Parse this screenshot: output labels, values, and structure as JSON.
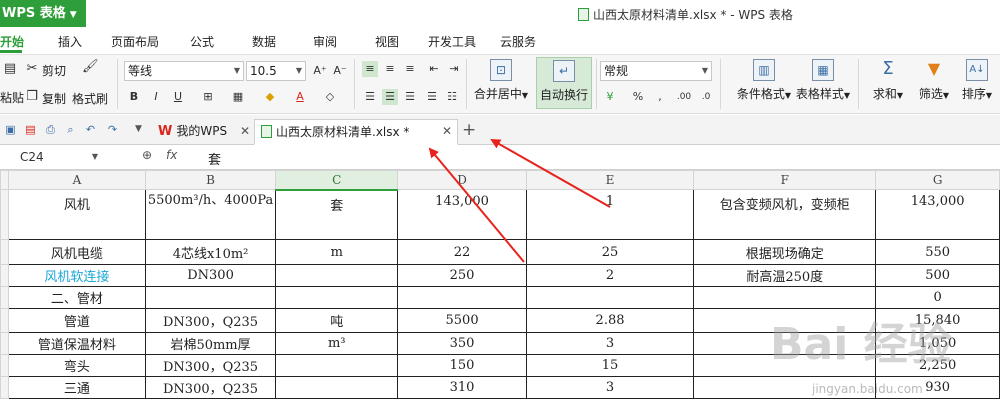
{
  "titlebar": {
    "app_label": "WPS 表格",
    "doc_title": "山西太原材料清单.xlsx * - WPS 表格"
  },
  "menu": {
    "tabs": [
      "开始",
      "插入",
      "页面布局",
      "公式",
      "数据",
      "审阅",
      "视图",
      "开发工具",
      "云服务"
    ]
  },
  "ribbon": {
    "paste": "粘贴",
    "cut": "剪切",
    "copy": "复制",
    "format_painter": "格式刷",
    "font_name": "等线",
    "font_size": "10.5",
    "merge_center": "合并居中",
    "wrap_text": "自动换行",
    "number_format": "常规",
    "conditional_format": "条件格式",
    "table_style": "表格样式",
    "sum": "求和",
    "filter": "筛选",
    "sort": "排序"
  },
  "tabs": {
    "my_wps": "我的WPS",
    "active_doc": "山西太原材料清单.xlsx *"
  },
  "formula_bar": {
    "cell_ref": "C24",
    "fx": "fx",
    "content": "套"
  },
  "sheet": {
    "columns": [
      "A",
      "B",
      "C",
      "D",
      "E",
      "F",
      "G"
    ],
    "rows": [
      [
        "风机",
        "5500m³/h、4000Pa",
        "套",
        "143,000",
        "1",
        "包含变频风机，变频柜",
        "143,000"
      ],
      [
        "风机电缆",
        "4芯线x10m²",
        "m",
        "22",
        "25",
        "根据现场确定",
        "550"
      ],
      [
        "风机软连接",
        "DN300",
        "",
        "250",
        "2",
        "耐高温250度",
        "500"
      ],
      [
        "二、管材",
        "",
        "",
        "",
        "",
        "",
        "0"
      ],
      [
        "管道",
        "DN300，Q235",
        "吨",
        "5500",
        "2.88",
        "",
        "15,840"
      ],
      [
        "管道保温材料",
        "岩棉50mm厚",
        "m³",
        "350",
        "3",
        "",
        "1,050"
      ],
      [
        "弯头",
        "DN300，Q235",
        "",
        "150",
        "15",
        "",
        "2,250"
      ],
      [
        "三通",
        "DN300，Q235",
        "",
        "310",
        "3",
        "",
        "930"
      ]
    ]
  },
  "watermark": {
    "text": "Bai 经验",
    "sub": "jingyan.baidu.com"
  },
  "colors": {
    "accent_green": "#2e9e3a",
    "link_cyan": "#19a6d8",
    "arrow_red": "#e8231c"
  }
}
